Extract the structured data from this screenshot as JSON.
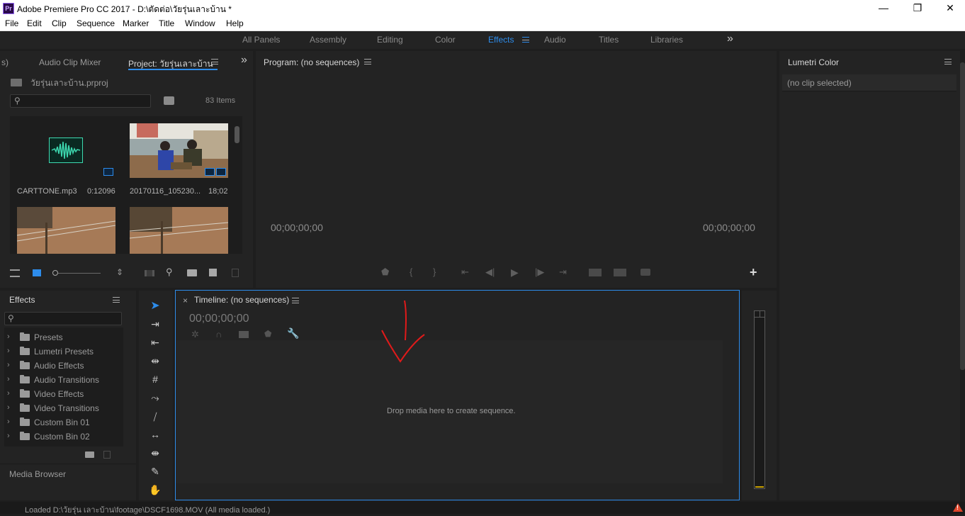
{
  "window": {
    "title": "Adobe Premiere Pro CC 2017 - D:\\ตัดต่อ\\วัยรุ่นเลาะบ้าน *",
    "app_icon_label": "Pr",
    "minimize": "—",
    "maximize": "❐",
    "close": "✕"
  },
  "menu": [
    "File",
    "Edit",
    "Clip",
    "Sequence",
    "Marker",
    "Title",
    "Window",
    "Help"
  ],
  "workspaces": {
    "tabs": [
      "All Panels",
      "Assembly",
      "Editing",
      "Color",
      "Effects",
      "Audio",
      "Titles",
      "Libraries"
    ],
    "active": "Effects",
    "overflow": "»"
  },
  "project_panel": {
    "tab_cut": "s)",
    "tab_audio_mixer": "Audio Clip Mixer",
    "tab_project": "Project: วัยรุ่นเลาะบ้าน",
    "overflow": "»",
    "project_file": "วัยรุ่นเลาะบ้าน.prproj",
    "search_placeholder": "",
    "item_count": "83 Items",
    "items": [
      {
        "name": "CARTTONE.mp3",
        "duration": "0:12096"
      },
      {
        "name": "20170116_105230...",
        "duration": "18;02"
      },
      {
        "name": "",
        "duration": ""
      },
      {
        "name": "",
        "duration": ""
      }
    ]
  },
  "program_monitor": {
    "title": "Program: (no sequences)",
    "timecode_left": "00;00;00;00",
    "timecode_right": "00;00;00;00",
    "add_button": "+"
  },
  "lumetri": {
    "title": "Lumetri Color",
    "clip_status": "(no clip selected)"
  },
  "effects_panel": {
    "title": "Effects",
    "search_placeholder": "",
    "items": [
      "Presets",
      "Lumetri Presets",
      "Audio Effects",
      "Audio Transitions",
      "Video Effects",
      "Video Transitions",
      "Custom Bin 01",
      "Custom Bin 02"
    ],
    "media_browser": "Media Browser"
  },
  "timeline": {
    "close": "×",
    "title": "Timeline: (no sequences)",
    "timecode": "00;00;00;00",
    "drop_hint": "Drop media here to create sequence."
  },
  "status_bar": {
    "message": "Loaded D:\\วัยรุ่น เลาะบ้าน\\footage\\DSCF1698.MOV (All media loaded.)",
    "warning": "!"
  },
  "colors": {
    "accent": "#2d8ceb",
    "panel_bg": "#232323",
    "app_bg": "#1e1e1e",
    "annotation_red": "#e01a1a",
    "audio_wave": "#3dd9b0",
    "warning": "#e0442a"
  }
}
